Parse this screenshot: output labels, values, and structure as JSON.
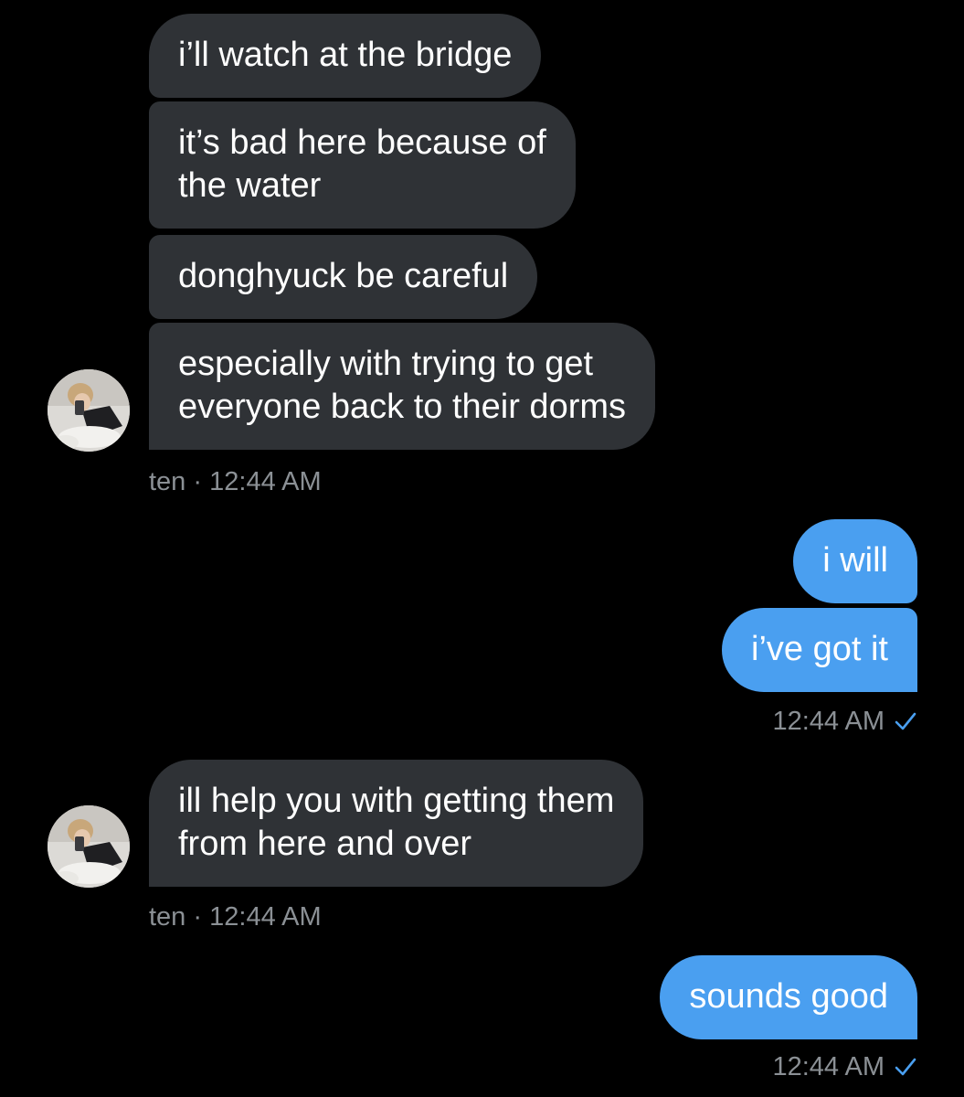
{
  "conversation": {
    "group1": {
      "messages": [
        "i’ll watch at the bridge",
        "it’s bad here because of\nthe water",
        "donghyuck be careful",
        "especially with trying to get\neveryone back to their dorms"
      ],
      "sender": "ten",
      "separator": "·",
      "time": "12:44 AM"
    },
    "group2": {
      "messages": [
        "i will",
        "i’ve got it"
      ],
      "time": "12:44 AM",
      "status_icon": "checkmark-icon"
    },
    "group3": {
      "messages": [
        "ill help you with getting them\nfrom here and over"
      ],
      "sender": "ten",
      "separator": "·",
      "time": "12:44 AM"
    },
    "group4": {
      "messages": [
        "sounds good"
      ],
      "time": "12:44 AM",
      "status_icon": "checkmark-icon"
    }
  },
  "colors": {
    "background": "#000000",
    "incoming_bubble": "#2f3236",
    "outgoing_bubble": "#4a9ff0",
    "meta_text": "#8b9095",
    "check": "#4a9ff0"
  }
}
